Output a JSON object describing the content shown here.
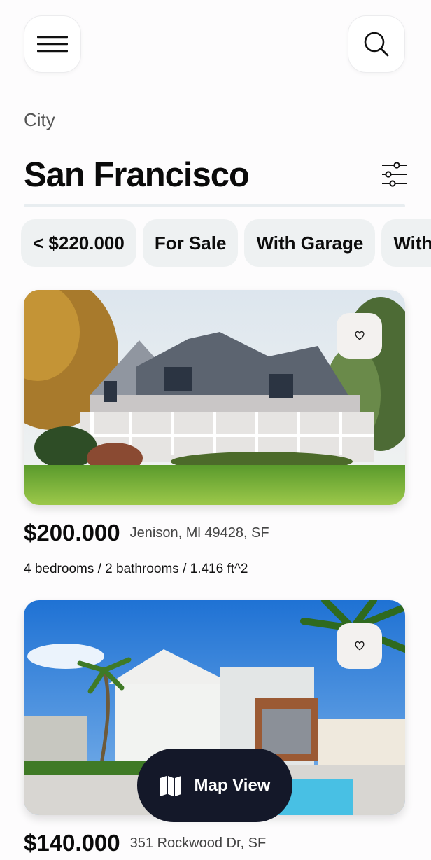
{
  "header": {
    "menu_icon": "hamburger-menu-icon",
    "search_icon": "search-icon"
  },
  "location": {
    "label": "City",
    "title": "San Francisco",
    "filter_icon": "sliders-filter-icon"
  },
  "filters": [
    {
      "label": "< $220.000"
    },
    {
      "label": "For Sale"
    },
    {
      "label": "With Garage"
    },
    {
      "label": "With B"
    }
  ],
  "listings": [
    {
      "price": "$200.000",
      "address": "Jenison, Ml 49428, SF",
      "details": "4 bedrooms / 2 bathrooms / 1.416 ft^2",
      "favorite_icon": "heart-icon",
      "image": "house-photo"
    },
    {
      "price": "$140.000",
      "address": "351 Rockwood Dr, SF",
      "details": "",
      "favorite_icon": "heart-icon",
      "image": "house-photo"
    }
  ],
  "map_view": {
    "label": "Map View",
    "icon": "map-icon"
  },
  "colors": {
    "background": "#fdfcfd",
    "chip_bg": "#eef1f2",
    "map_button_bg": "#141829",
    "divider": "#e8edf0"
  }
}
